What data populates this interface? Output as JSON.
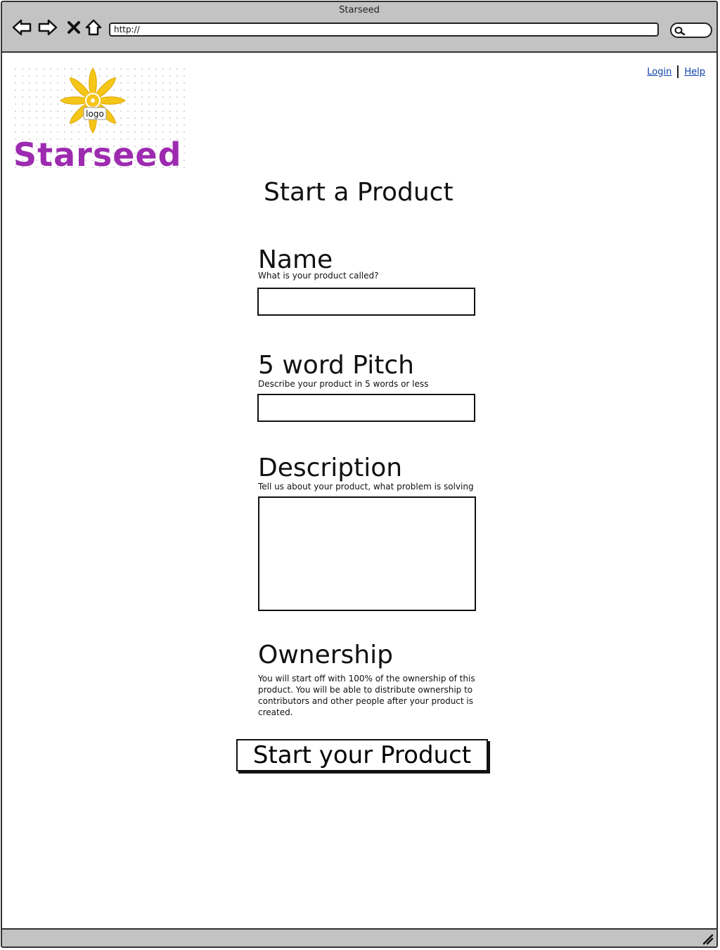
{
  "window": {
    "title": "Starseed"
  },
  "browser": {
    "url": "http://",
    "nav": {
      "back_icon": "arrow-left-icon",
      "forward_icon": "arrow-right-icon",
      "stop_icon": "close-icon",
      "home_icon": "home-icon"
    },
    "search_icon": "search-icon"
  },
  "header": {
    "logo_label": "logo",
    "brand_name": "Starseed",
    "links": {
      "login": "Login",
      "help": "Help"
    }
  },
  "form": {
    "title": "Start a Product",
    "name": {
      "label": "Name",
      "help": "What is your product called?",
      "value": ""
    },
    "pitch": {
      "label": "5 word Pitch",
      "help": "Describe your product in 5 words or less",
      "value": ""
    },
    "description": {
      "label": "Description",
      "help": "Tell us about your product, what problem is solving",
      "value": ""
    },
    "ownership": {
      "label": "Ownership",
      "text": "You will start off with 100% of the ownership of this product. You will be able to distribute ownership to contributors and other people after your product is created."
    },
    "submit_label": "Start your Product"
  },
  "colors": {
    "brand": "#9d2bb0",
    "logo_yellow": "#f5c518",
    "link": "#0b3fa8",
    "chrome": "#c3c3c3"
  }
}
